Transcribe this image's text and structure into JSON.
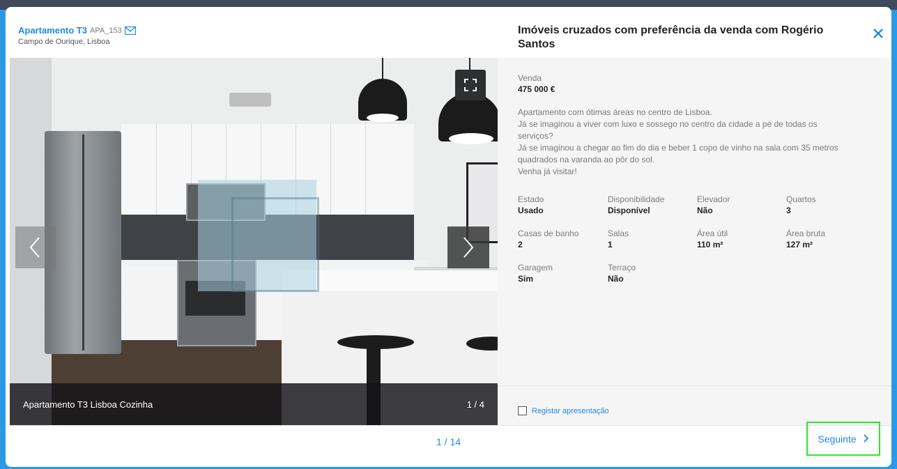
{
  "header": {
    "property_title": "Apartamento T3",
    "property_ref": "APA_153",
    "property_location": "Campo de Ourique, Lisboa",
    "dialog_title": "Imóveis cruzados com preferência da venda com Rogério Santos",
    "close_icon": "close-icon",
    "mail_icon": "mail-icon"
  },
  "gallery": {
    "caption": "Apartamento T3 Lisboa Cozinha",
    "counter": "1 / 4",
    "fullscreen_icon": "fullscreen-icon",
    "prev_icon": "chevron-left-icon",
    "next_icon": "chevron-right-icon"
  },
  "details": {
    "sale_label": "Venda",
    "sale_price": "475 000 €",
    "description": [
      "Apartamento com ótimas áreas no centro de Lisboa.",
      "Já se imaginou a viver com luxo e sossego no centro da cidade a pé de todas os",
      "serviços?",
      "Já se imaginou a chegar ao fim do dia e beber 1 copo de vinho na sala com 35 metros",
      "quadrados na varanda ao pôr do sol.",
      "Venha já visitar!"
    ],
    "attributes": [
      {
        "label": "Estado",
        "value": "Usado"
      },
      {
        "label": "Disponibilidade",
        "value": "Disponível"
      },
      {
        "label": "Elevador",
        "value": "Não"
      },
      {
        "label": "Quartos",
        "value": "3"
      },
      {
        "label": "Casas de banho",
        "value": "2"
      },
      {
        "label": "Salas",
        "value": "1"
      },
      {
        "label": "Área útil",
        "value": "110 m²"
      },
      {
        "label": "Área bruta",
        "value": "127 m²"
      },
      {
        "label": "Garagem",
        "value": "Sim"
      },
      {
        "label": "Terraço",
        "value": "Não"
      }
    ],
    "register_label": "Registar apresentação"
  },
  "footer": {
    "pager": "1 / 14",
    "next_label": "Seguinte",
    "next_icon": "chevron-right-icon"
  },
  "colors": {
    "accent": "#1e88e5",
    "frame": "#2a9ae6",
    "highlight": "#2ee62e"
  }
}
